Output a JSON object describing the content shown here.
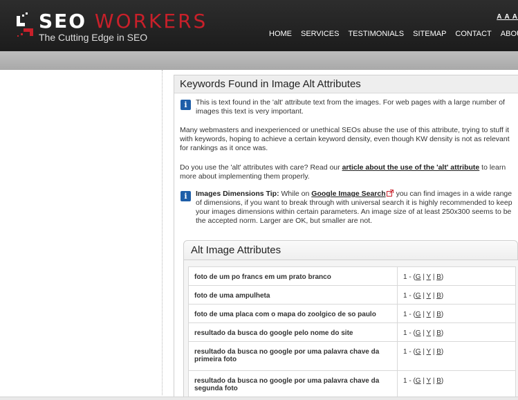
{
  "brand": {
    "name_part1": "SEO",
    "name_part2": "WORKERS",
    "tagline": "The Cutting Edge in SEO",
    "accent": "#c8202a"
  },
  "text_size_controls": "A A A",
  "nav": [
    "HOME",
    "SERVICES",
    "TESTIMONIALS",
    "SITEMAP",
    "CONTACT",
    "ABOUT US"
  ],
  "panel": {
    "title": "Keywords Found in Image Alt Attributes",
    "info1": "This is text found in the 'alt' attribute text from the images. For web pages with a large number of images this text is very important.",
    "para1": "Many webmasters and inexperienced or unethical SEOs abuse the use of this attribute, trying to stuff it with keywords, hoping to achieve a certain keyword density, even though KW density is not as relevant for rankings as it once was.",
    "para2_pre": "Do you use the 'alt' attributes with care? Read our ",
    "para2_link": "article about the use of the 'alt' attribute",
    "para2_post": " to learn more about implementing them properly.",
    "tip_label": "Images Dimensions Tip:",
    "tip_pre": " While on ",
    "tip_link": "Google Image Search",
    "tip_post": " you can find images in a wide range of dimensions, if you want to break through with universal search it is highly recommended to keep your images dimensions within certain parameters. An image size of at least 250x300 seems to be the accepted norm. Larger are OK, but smaller are not."
  },
  "alt_section": {
    "title": "Alt Image Attributes",
    "rows": [
      {
        "text": "foto de um po francs em um prato branco",
        "count": "1 - (",
        "g": "G",
        "y": "Y",
        "b": "B",
        "close": ")"
      },
      {
        "text": "foto de uma ampulheta",
        "count": "1 - (",
        "g": "G",
        "y": "Y",
        "b": "B",
        "close": ")"
      },
      {
        "text": "foto de uma placa com o mapa do zoolgico de so paulo",
        "count": "1 - (",
        "g": "G",
        "y": "Y",
        "b": "B",
        "close": ")"
      },
      {
        "text": "resultado da busca do google pelo nome do site",
        "count": "1 - (",
        "g": "G",
        "y": "Y",
        "b": "B",
        "close": ")"
      },
      {
        "text": "resultado da busca no google por uma palavra chave da primeira foto",
        "count": "1 - (",
        "g": "G",
        "y": "Y",
        "b": "B",
        "close": ")"
      },
      {
        "text": "resultado da busca no google por uma palavra chave da segunda foto",
        "count": "1 - (",
        "g": "G",
        "y": "Y",
        "b": "B",
        "close": ")"
      }
    ]
  }
}
